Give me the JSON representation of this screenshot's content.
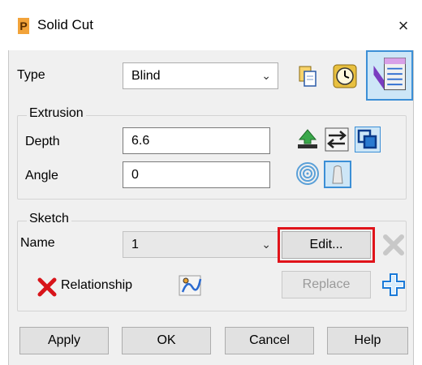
{
  "window": {
    "title": "Solid Cut",
    "close_glyph": "×",
    "app_icon": "P"
  },
  "type_row": {
    "label": "Type",
    "value": "Blind",
    "icons": [
      "copy-icon",
      "history-clock-icon",
      "table-view-icon"
    ]
  },
  "extrusion": {
    "group_title": "Extrusion",
    "depth": {
      "label": "Depth",
      "value": "6.6"
    },
    "angle": {
      "label": "Angle",
      "value": "0"
    },
    "icons": [
      "extrude-up-icon",
      "swap-direction-icon",
      "boolean-icon",
      "concentric-icon",
      "taper-icon"
    ]
  },
  "sketch": {
    "group_title": "Sketch",
    "name": {
      "label": "Name",
      "value": "1"
    },
    "edit_label": "Edit...",
    "replace_label": "Replace",
    "relationship_label": "Relationship",
    "icons": [
      "delete-x-icon",
      "relationship-x-icon",
      "sketch-curve-icon",
      "add-plus-icon"
    ],
    "highlight_color": "#e0131a"
  },
  "buttons": {
    "apply": "Apply",
    "ok": "OK",
    "cancel": "Cancel",
    "help": "Help"
  }
}
